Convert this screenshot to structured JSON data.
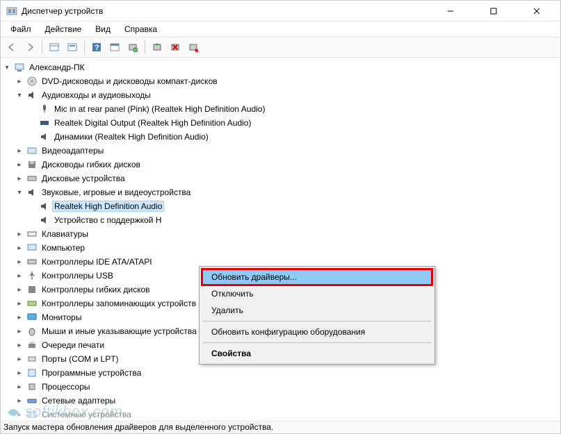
{
  "window": {
    "title": "Диспетчер устройств"
  },
  "menu": {
    "file": "Файл",
    "action": "Действие",
    "view": "Вид",
    "help": "Справка"
  },
  "tree": {
    "root": "Александр-ПК",
    "dvd": "DVD-дисководы и дисководы компакт-дисков",
    "audio_io": "Аудиовходы и аудиовыходы",
    "audio_io_children": {
      "mic": "Mic in at rear panel (Pink) (Realtek High Definition Audio)",
      "spdif": "Realtek Digital Output (Realtek High Definition Audio)",
      "speakers": "Динамики (Realtek High Definition Audio)"
    },
    "video_adapters": "Видеоадаптеры",
    "floppy_drives": "Дисководы гибких дисков",
    "disk_drives": "Дисковые устройства",
    "sound_game": "Звуковые, игровые и видеоустройства",
    "sound_game_children": {
      "realtek": "Realtek High Definition Audio",
      "hd_support": "Устройство с поддержкой H"
    },
    "keyboards": "Клавиатуры",
    "computer": "Компьютер",
    "ide": "Контроллеры IDE ATA/ATAPI",
    "usb": "Контроллеры USB",
    "floppy_ctrl": "Контроллеры гибких дисков",
    "storage_ctrl": "Контроллеры запоминающих устройств",
    "monitors": "Мониторы",
    "mice": "Мыши и иные указывающие устройства",
    "print_queues": "Очереди печати",
    "ports": "Порты (COM и LPT)",
    "software_devices": "Программные устройства",
    "processors": "Процессоры",
    "network": "Сетевые адаптеры",
    "system": "Системные устройства"
  },
  "context_menu": {
    "update": "Обновить драйверы...",
    "disable": "Отключить",
    "uninstall": "Удалить",
    "scan": "Обновить конфигурацию оборудования",
    "properties": "Свойства"
  },
  "statusbar": "Запуск мастера обновления драйверов для выделенного устройства.",
  "watermark": "softikbox.com"
}
